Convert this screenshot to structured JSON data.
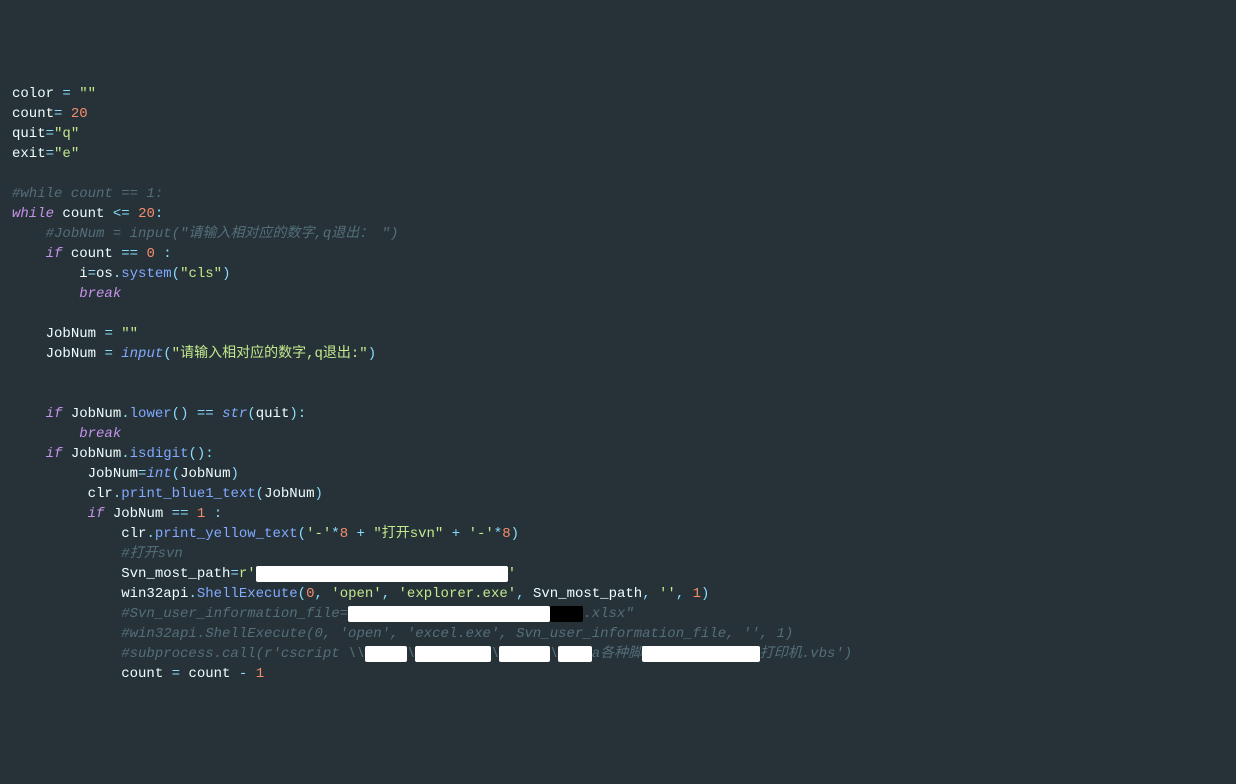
{
  "lines": {
    "l1": {
      "var": "color",
      "op": "=",
      "val": "\"\""
    },
    "l2": {
      "var": "count",
      "op": "=",
      "val": "20"
    },
    "l3": {
      "var": "quit",
      "op": "=",
      "val": "\"q\""
    },
    "l4": {
      "var": "exit",
      "op": "=",
      "val": "\"e\""
    },
    "l6": {
      "comment": "#while count == 1:"
    },
    "l7": {
      "kw1": "while",
      "var": "count",
      "op": "<=",
      "num": "20",
      "colon": ":"
    },
    "l8": {
      "comment": "#JobNum = input(\"请输入相对应的数字,q退出： \")"
    },
    "l9": {
      "kw": "if",
      "var": "count",
      "op": "==",
      "num": "0",
      "colon": ":"
    },
    "l10": {
      "var": "i",
      "op": "=",
      "obj": "os",
      "dot": ".",
      "fn": "system",
      "lp": "(",
      "str": "\"cls\"",
      "rp": ")"
    },
    "l11": {
      "kw": "break"
    },
    "l13": {
      "var": "JobNum",
      "op": "=",
      "val": "\"\""
    },
    "l14": {
      "var": "JobNum",
      "op": "=",
      "fn": "input",
      "lp": "(",
      "str": "\"请输入相对应的数字,q退出:\"",
      "rp": ")"
    },
    "l17": {
      "kw": "if",
      "var": "JobNum",
      "dot": ".",
      "fn": "lower",
      "lp": "(",
      "rp": ")",
      "op": "==",
      "bi": "str",
      "lp2": "(",
      "arg": "quit",
      "rp2": ")",
      "colon": ":"
    },
    "l18": {
      "kw": "break"
    },
    "l19": {
      "kw": "if",
      "var": "JobNum",
      "dot": ".",
      "fn": "isdigit",
      "lp": "(",
      "rp": ")",
      "colon": ":"
    },
    "l20": {
      "var": "JobNum",
      "op": "=",
      "bi": "int",
      "lp": "(",
      "arg": "JobNum",
      "rp": ")"
    },
    "l21": {
      "obj": "clr",
      "dot": ".",
      "fn": "print_blue1_text",
      "lp": "(",
      "arg": "JobNum",
      "rp": ")"
    },
    "l22": {
      "kw": "if",
      "var": "JobNum",
      "op": "==",
      "num": "1",
      "colon": ":"
    },
    "l23": {
      "obj": "clr",
      "dot": ".",
      "fn": "print_yellow_text",
      "lp": "(",
      "s1": "'-'",
      "mul1": "*",
      "n1": "8",
      "plus1": "+",
      "s2": "\"打开svn\"",
      "plus2": "+",
      "s3": "'-'",
      "mul2": "*",
      "n2": "8",
      "rp": ")"
    },
    "l24": {
      "comment": "#打开svn"
    },
    "l25": {
      "var": "Svn_most_path",
      "op": "=",
      "pfx": "r",
      "q1": "'",
      "red": "xxxxxxxxxxxxxxxxxxxxxxxxxxxxxx",
      "q2": "'"
    },
    "l26": {
      "obj": "win32api",
      "dot": ".",
      "fn": "ShellExecute",
      "lp": "(",
      "a1": "0",
      "c1": ",",
      "a2": "'open'",
      "c2": ",",
      "a3": "'explorer.exe'",
      "c3": ",",
      "a4": "Svn_most_path",
      "c4": ",",
      "a5": "''",
      "c5": ",",
      "a6": "1",
      "rp": ")"
    },
    "l27": {
      "p1": "#Svn_user_information_file=",
      "red": "xxxxxxxxxxxxxxxxxxxxxxxx",
      "p2": "xxxx",
      "p3": ".xlsx\""
    },
    "l28": {
      "comment": "#win32api.ShellExecute(0, 'open', 'excel.exe', Svn_user_information_file, '', 1)"
    },
    "l29": {
      "p1": "#subprocess.call(r'cscript \\\\",
      "r1": "xxxxx",
      "p2": "\\",
      "r2": "xxxxxxxxx",
      "p3": "\\",
      "r3": "xxxxxx",
      "p4": "\\",
      "r4": "xxxx",
      "p5": "a各种脚",
      "r5": "xxxxxxxxxxxxxx",
      "p6": "打印机.vbs')"
    },
    "l30": {
      "var": "count",
      "op1": "=",
      "var2": "count",
      "op2": "-",
      "num": "1"
    }
  }
}
